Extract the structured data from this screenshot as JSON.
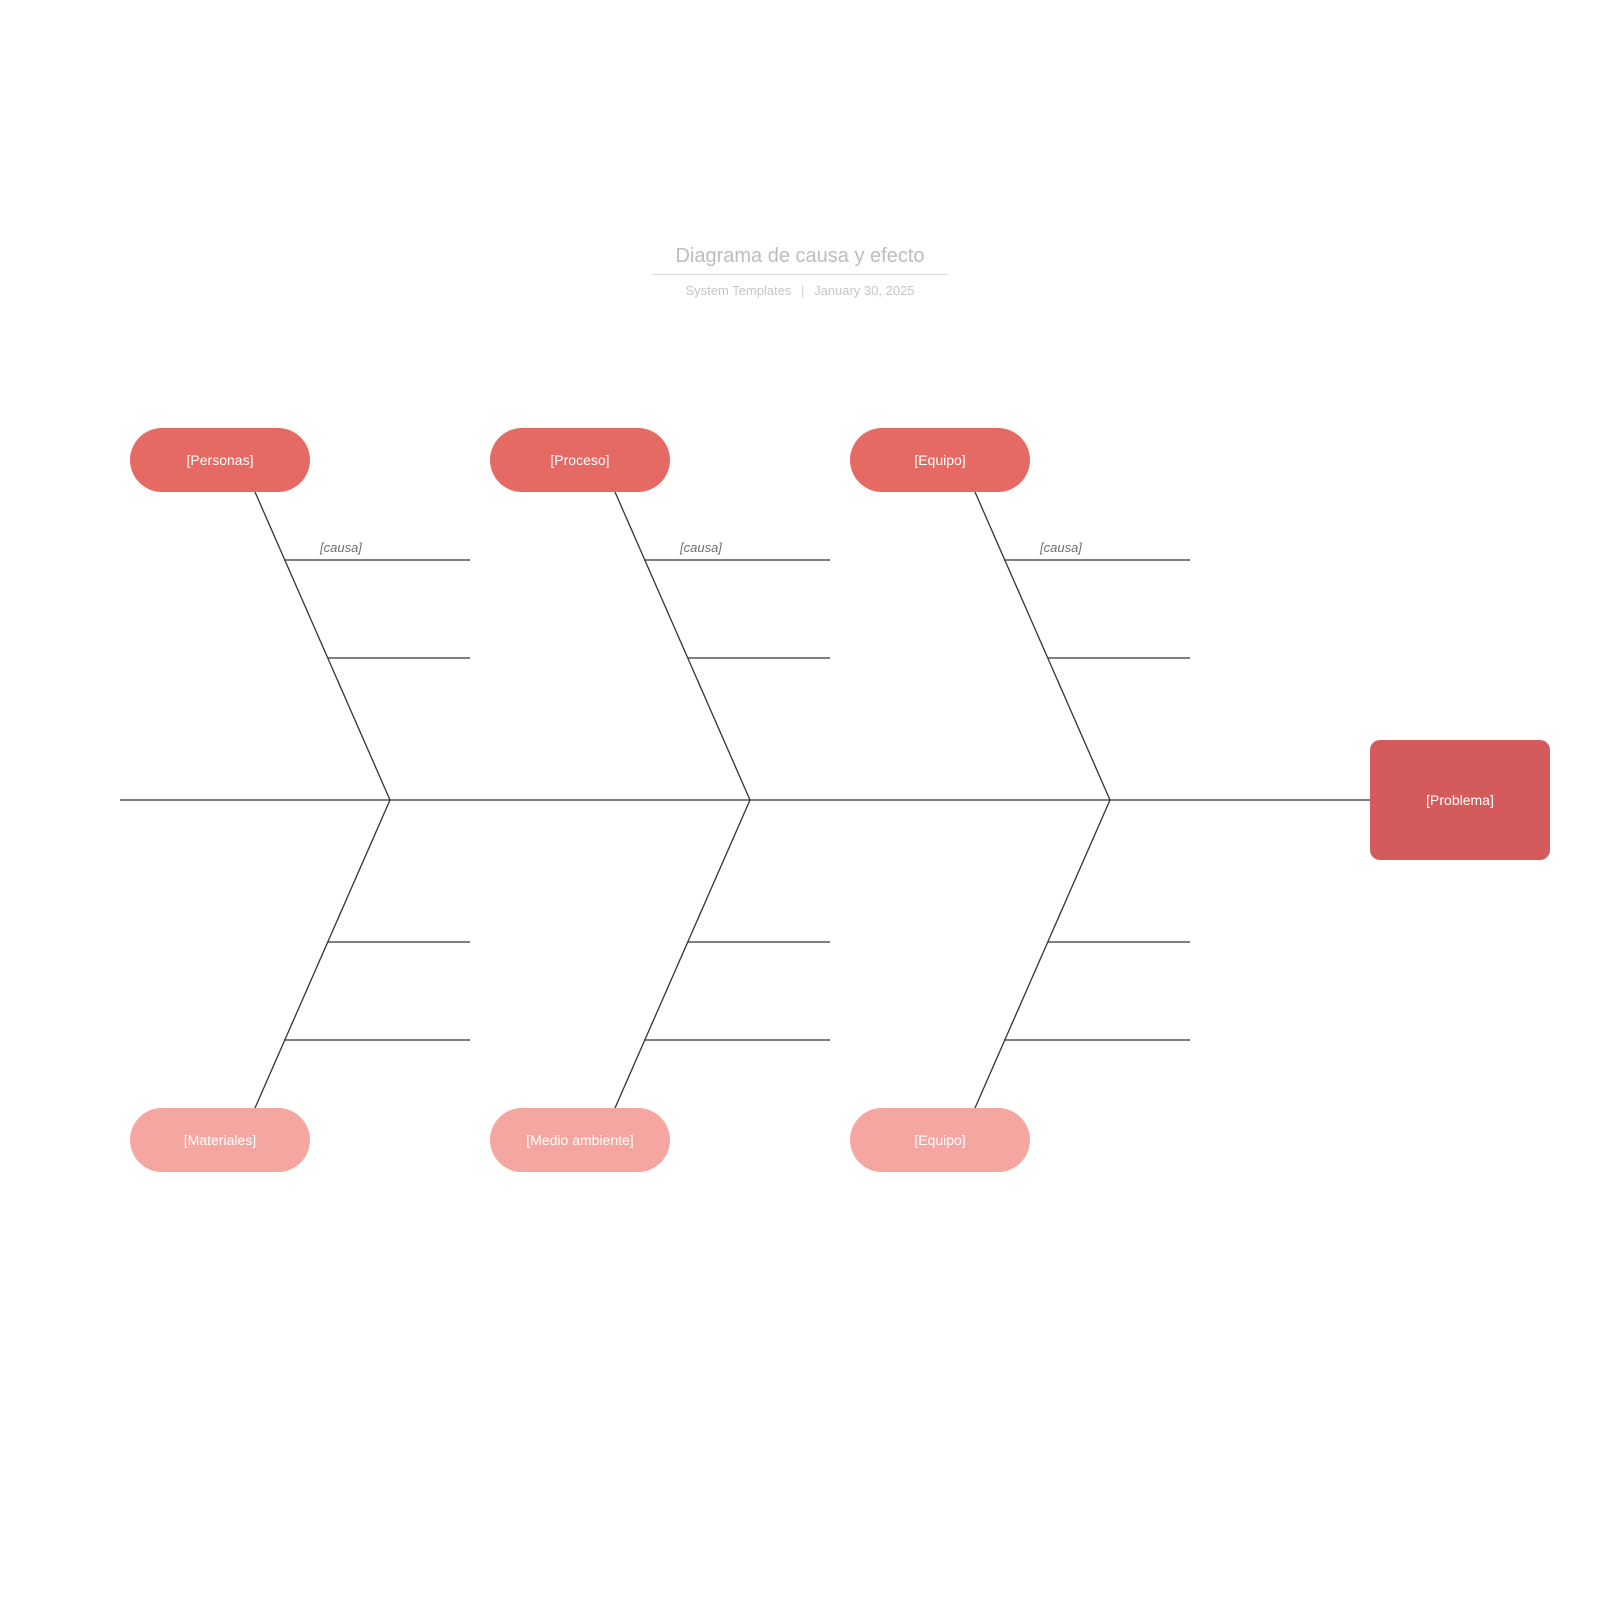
{
  "header": {
    "title": "Diagrama de causa y efecto",
    "author": "System Templates",
    "date": "January 30, 2025"
  },
  "top_categories": [
    "[Personas]",
    "[Proceso]",
    "[Equipo]"
  ],
  "bottom_categories": [
    "[Materiales]",
    "[Medio ambiente]",
    "[Equipo]"
  ],
  "cause_labels": [
    "[causa]",
    "[causa]",
    "[causa]"
  ],
  "problem": "[Problema]",
  "colors": {
    "top_pill": "#e66a64",
    "bottom_pill": "#f6a6a1",
    "problem_box": "#d45b5b",
    "line": "#333333",
    "title_text": "#bdbdbd",
    "subtitle_text": "#c6c6c6"
  }
}
